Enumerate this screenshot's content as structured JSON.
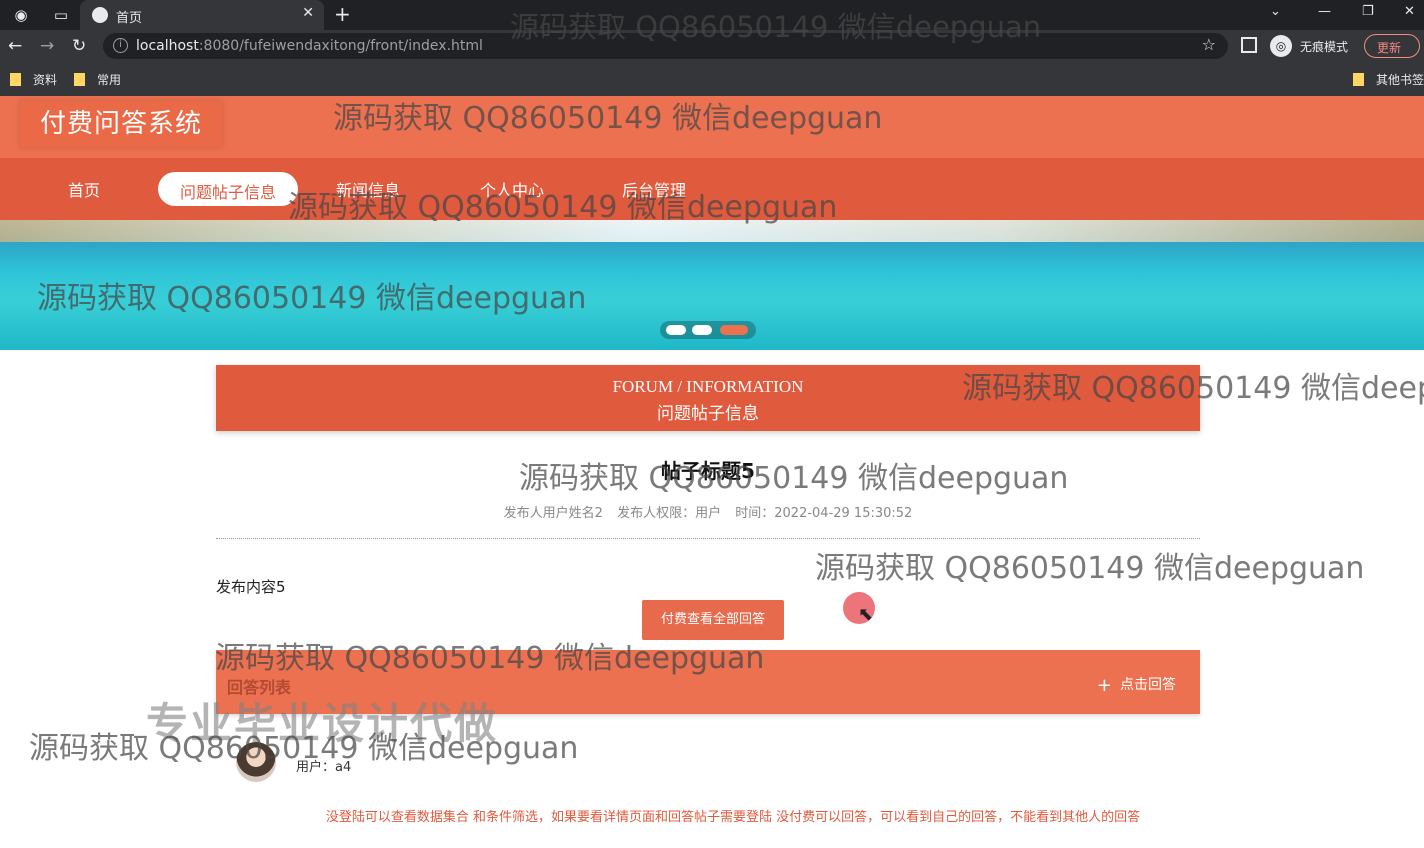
{
  "browser": {
    "tab_title": "首页",
    "url_host": "localhost",
    "url_rest": ":8080/fufeiwendaxitong/front/index.html",
    "incognito_label": "无痕模式",
    "update_label": "更新",
    "bookmarks": [
      "资料",
      "常用"
    ],
    "other_bookmarks": "其他书签"
  },
  "site": {
    "logo": "付费问答系统",
    "nav": [
      "首页",
      "问题帖子信息",
      "新闻信息",
      "个人中心",
      "后台管理"
    ],
    "active_nav": "问题帖子信息"
  },
  "section": {
    "title_en": "FORUM / INFORMATION",
    "title_cn": "问题帖子信息"
  },
  "post": {
    "title": "帖子标题5",
    "author": "发布人用户姓名2",
    "role": "发布人权限：用户",
    "time": "时间：2022-04-29 15:30:52",
    "content": "发布内容5",
    "pay_button": "付费查看全部回答"
  },
  "answers": {
    "title": "回答列表",
    "add_button": "点击回答",
    "items": [
      {
        "user": "用户：a4"
      }
    ]
  },
  "notice": "没登陆可以查看数据集合 和条件筛选，如果要看详情页面和回答帖子需要登陆 没付费可以回答，可以看到自己的回答，不能看到其他人的回答",
  "overlays": {
    "watermark": "源码获取 QQ86050149 微信deepguan",
    "promo": "专业毕业设计代做"
  },
  "colors": {
    "primary": "#e05a3d",
    "header": "#ec7150"
  }
}
